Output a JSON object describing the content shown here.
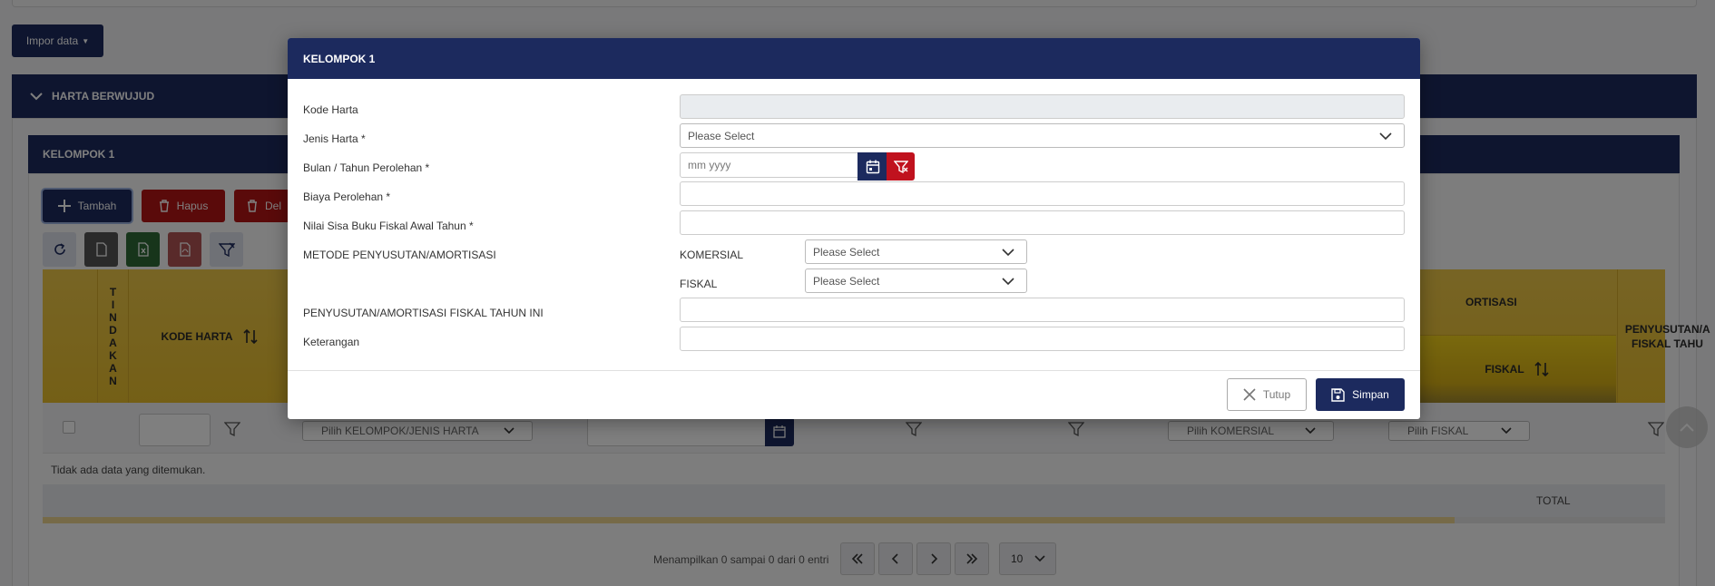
{
  "page": {
    "import_label": "Impor data",
    "section_title": "HARTA BERWUJUD",
    "group_title": "KELOMPOK 1",
    "toolbar": {
      "add_label": "Tambah",
      "delete_label": "Hapus",
      "delete2_label": "Del"
    },
    "table": {
      "col_tindakan": "TINDAKAN",
      "col_kode_harta": "KODE HARTA",
      "col_amortisasi_partial": "ORTISASI",
      "col_fiskal": "FISKAL",
      "col_penyusutan_partial": "PENYUSUTAN/A FISKAL TAHU",
      "filter_kelompok_placeholder": "Pilih KELOMPOK/JENIS HARTA",
      "filter_komersial_placeholder": "Pilih KOMERSIAL",
      "filter_fiskal_placeholder": "Pilih FISKAL",
      "empty_message": "Tidak ada data yang ditemukan.",
      "total_label": "TOTAL"
    },
    "pagination": {
      "info": "Menampilkan 0 sampai 0 dari 0 entri",
      "page_size": "10"
    }
  },
  "modal": {
    "title": "KELOMPOK 1",
    "fields": {
      "kode_harta_label": "Kode Harta",
      "kode_harta_value": "",
      "jenis_harta_label": "Jenis Harta *",
      "jenis_harta_value": "Please Select",
      "bulan_tahun_label": "Bulan / Tahun Perolehan *",
      "bulan_tahun_placeholder": "mm yyyy",
      "biaya_label": "Biaya Perolehan *",
      "nilai_sisa_label": "Nilai Sisa Buku Fiskal Awal Tahun *",
      "metode_label": "METODE PENYUSUTAN/AMORTISASI",
      "komersial_label": "KOMERSIAL",
      "komersial_value": "Please Select",
      "fiskal_label": "FISKAL",
      "fiskal_value": "Please Select",
      "penyusutan_label": "PENYUSUTAN/AMORTISASI FISKAL TAHUN INI",
      "keterangan_label": "Keterangan"
    },
    "buttons": {
      "close_label": "Tutup",
      "save_label": "Simpan"
    }
  },
  "colors": {
    "primary": "#1c2a5e",
    "danger": "#c0121e",
    "header_gold": "#e9bf2d"
  }
}
